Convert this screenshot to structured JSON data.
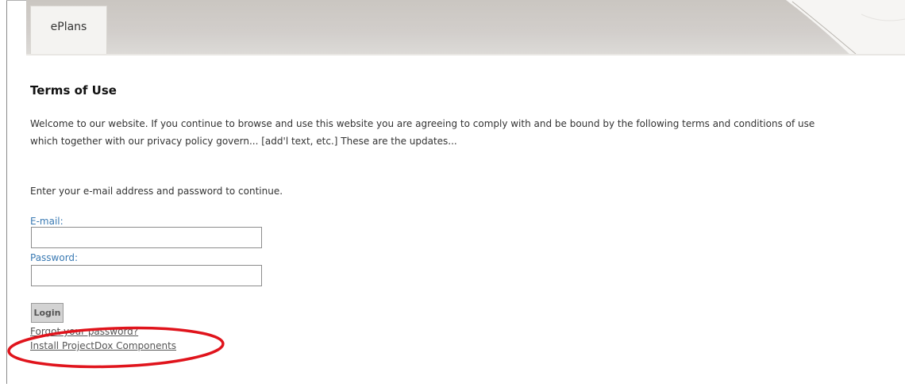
{
  "header": {
    "tab_label": "ePlans"
  },
  "terms": {
    "title": "Terms of Use",
    "line1": "Welcome to our website. If you continue to browse and use this website you are agreeing to comply with and be bound by the following terms and conditions of use",
    "line2": "which together with our privacy policy govern... [add'l text, etc.] These are the updates..."
  },
  "login_form": {
    "instructions": "Enter your e-mail address and password to continue.",
    "email_label": "E-mail:",
    "email_value": "",
    "password_label": "Password:",
    "password_value": "",
    "login_label": "Login",
    "forgot_link": "Forgot your password?",
    "install_link": "Install ProjectDox Components"
  },
  "colors": {
    "label_blue": "#3a7ab3",
    "callout_red": "#e0141c",
    "header_gray": "#cac6c1"
  }
}
